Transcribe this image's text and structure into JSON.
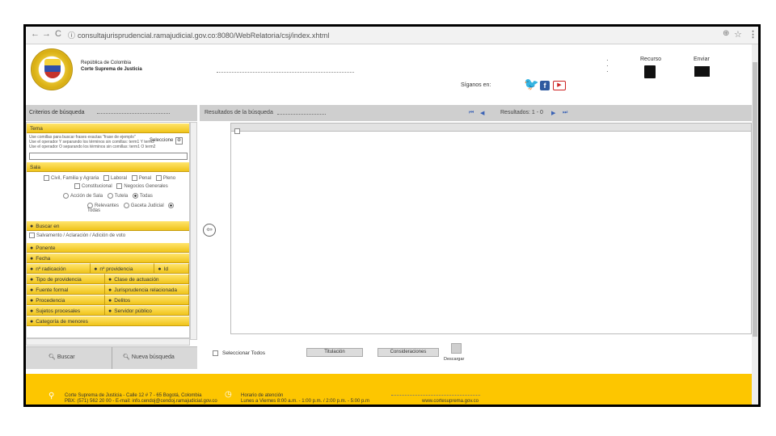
{
  "browser": {
    "url": "consultajurisprudencial.ramajudicial.gov.co:8080/WebRelatoria/csj/index.xhtml"
  },
  "header": {
    "entity_line1": "República de Colombia",
    "entity_line2": "Corte Suprema de Justicia",
    "follow_label": "Síganos en:",
    "rss_label": "Recurso",
    "send_label": "Enviar"
  },
  "left": {
    "criteria_title": "Criterios de búsqueda",
    "tema_label": "Tema",
    "tema_help1": "Use comillas para buscar frases exactas \"frase de ejemplo\"",
    "tema_help2": "Use el operador Y separando los términos sin comillas: term1 Y term2",
    "tema_help3": "Use el operador O separando los términos sin comillas: term1 O term2",
    "select_label": "Seleccione",
    "sala_label": "Sala",
    "sala_options": [
      "Civil, Familia y Agraria",
      "Laboral",
      "Penal",
      "Pleno",
      "Constitucional",
      "Negocios Generales"
    ],
    "radio_group1": [
      "Acción de Sala",
      "Tutela",
      "Todas"
    ],
    "radio_group2": [
      "Relevantes",
      "Gaceta Judicial",
      "Todas"
    ],
    "buscar_en": "Buscar en",
    "salvamentos": "Salvamento / Aclaración / Adición de voto",
    "ponente": "Ponente",
    "fecha": "Fecha",
    "grid1": [
      "nº radicación",
      "nº providencia",
      "Id"
    ],
    "grid2": [
      [
        "Tipo de providencia",
        "Clase de actuación"
      ],
      [
        "Fuente formal",
        "Jurisprudencia relacionada"
      ],
      [
        "Procedencia",
        "Delitos"
      ],
      [
        "Sujetos procesales",
        "Servidor público"
      ]
    ],
    "categoria": "Categoría de menores",
    "btn_search": "Buscar",
    "btn_new": "Nueva búsqueda"
  },
  "right": {
    "results_title": "Resultados de la búsqueda",
    "results_count": "Resultados: 1 - 0",
    "select_all": "Seleccionar Todos",
    "btn_titulacion": "Titulación",
    "btn_consideraciones": "Consideraciones",
    "descargar": "Descargar"
  },
  "footer": {
    "addr1": "Corte Suprema de Justicia - Calle 12 # 7 - 65 Bogotá, Colombia",
    "addr2": "PBX: (571) 562 20 00 - E-mail: info.cendoj@cendoj.ramajudicial.gov.co",
    "hours_title": "Horario de atención",
    "hours": "Lunes a Viernes 8:00 a.m. - 1:00 p.m. / 2:00 p.m. - 5:00 p.m",
    "web": "www.cortesuprema.gov.co"
  },
  "colors": {
    "brand_yellow": "#fdc600",
    "twitter_blue": "#2f5aa0",
    "youtube_red": "#cc2222"
  }
}
